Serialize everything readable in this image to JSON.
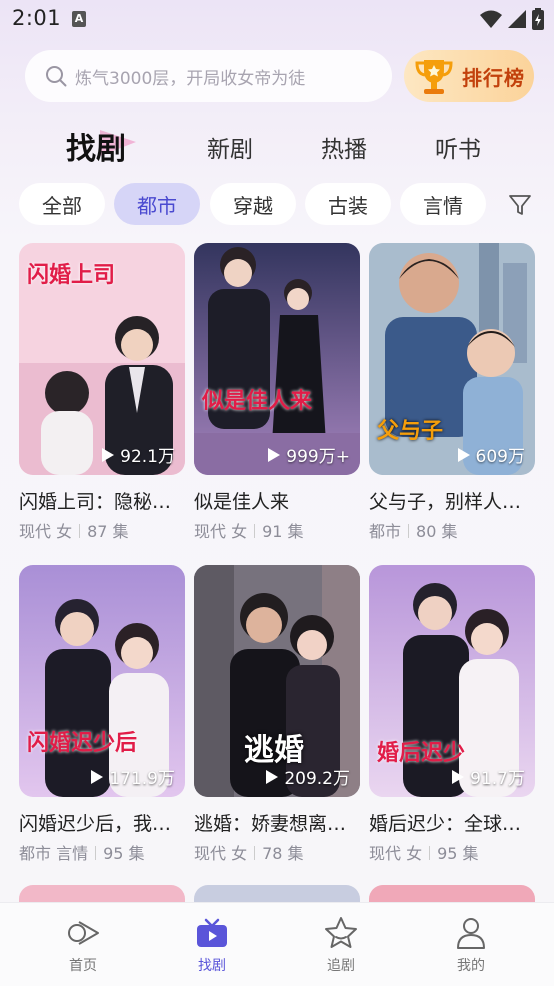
{
  "status_bar": {
    "time": "2:01",
    "notification_letter": "A"
  },
  "search": {
    "placeholder": "炼气3000层，开局收女帝为徒"
  },
  "rank_button": {
    "label": "排行榜"
  },
  "tabs": [
    {
      "label": "找剧",
      "active": true
    },
    {
      "label": "新剧",
      "active": false
    },
    {
      "label": "热播",
      "active": false
    },
    {
      "label": "听书",
      "active": false
    }
  ],
  "categories": [
    {
      "label": "全部",
      "active": false
    },
    {
      "label": "都市",
      "active": true
    },
    {
      "label": "穿越",
      "active": false
    },
    {
      "label": "古装",
      "active": false
    },
    {
      "label": "言情",
      "active": false
    }
  ],
  "dramas": [
    {
      "title": "闪婚上司：隐秘…",
      "poster_text": "闪婚上司",
      "views": "92.1万",
      "tags": "现代 女",
      "episodes": "87 集",
      "colors": [
        "#f7d7e3",
        "#e8b9cc",
        "#2a2a35"
      ]
    },
    {
      "title": "似是佳人来",
      "poster_text": "似是佳人来",
      "views": "999万+",
      "tags": "现代 女",
      "episodes": "91 集",
      "colors": [
        "#3d3f6e",
        "#9d7fb6",
        "#1a1a2a"
      ]
    },
    {
      "title": "父与子，别样人…",
      "poster_text": "父与子",
      "views": "609万",
      "tags": "都市",
      "episodes": "80 集",
      "colors": [
        "#9fb3c7",
        "#7a94b2",
        "#2e3e55"
      ]
    },
    {
      "title": "闪婚迟少后，我…",
      "poster_text": "闪婚迟少后",
      "views": "171.9万",
      "tags": "都市 言情",
      "episodes": "95 集",
      "colors": [
        "#b49ad9",
        "#d9b8e8",
        "#202033"
      ]
    },
    {
      "title": "逃婚：娇妻想离…",
      "poster_text": "逃婚",
      "views": "209.2万",
      "tags": "现代 女",
      "episodes": "78 集",
      "colors": [
        "#6e6a74",
        "#b28a8a",
        "#1e1c22"
      ]
    },
    {
      "title": "婚后迟少：全球…",
      "poster_text": "婚后迟少",
      "views": "91.7万",
      "tags": "现代 女",
      "episodes": "95 集",
      "colors": [
        "#c4a6e0",
        "#e6d0ee",
        "#1f1d2b"
      ]
    }
  ],
  "bottom_nav": [
    {
      "label": "首页",
      "icon": "home-play-icon",
      "active": false
    },
    {
      "label": "找剧",
      "icon": "tv-icon",
      "active": true
    },
    {
      "label": "追剧",
      "icon": "star-icon",
      "active": false
    },
    {
      "label": "我的",
      "icon": "user-icon",
      "active": false
    }
  ],
  "colors": {
    "accent": "#5a55d9",
    "chip_active_bg": "#d6d5f7",
    "rank_text": "#c2410c"
  }
}
